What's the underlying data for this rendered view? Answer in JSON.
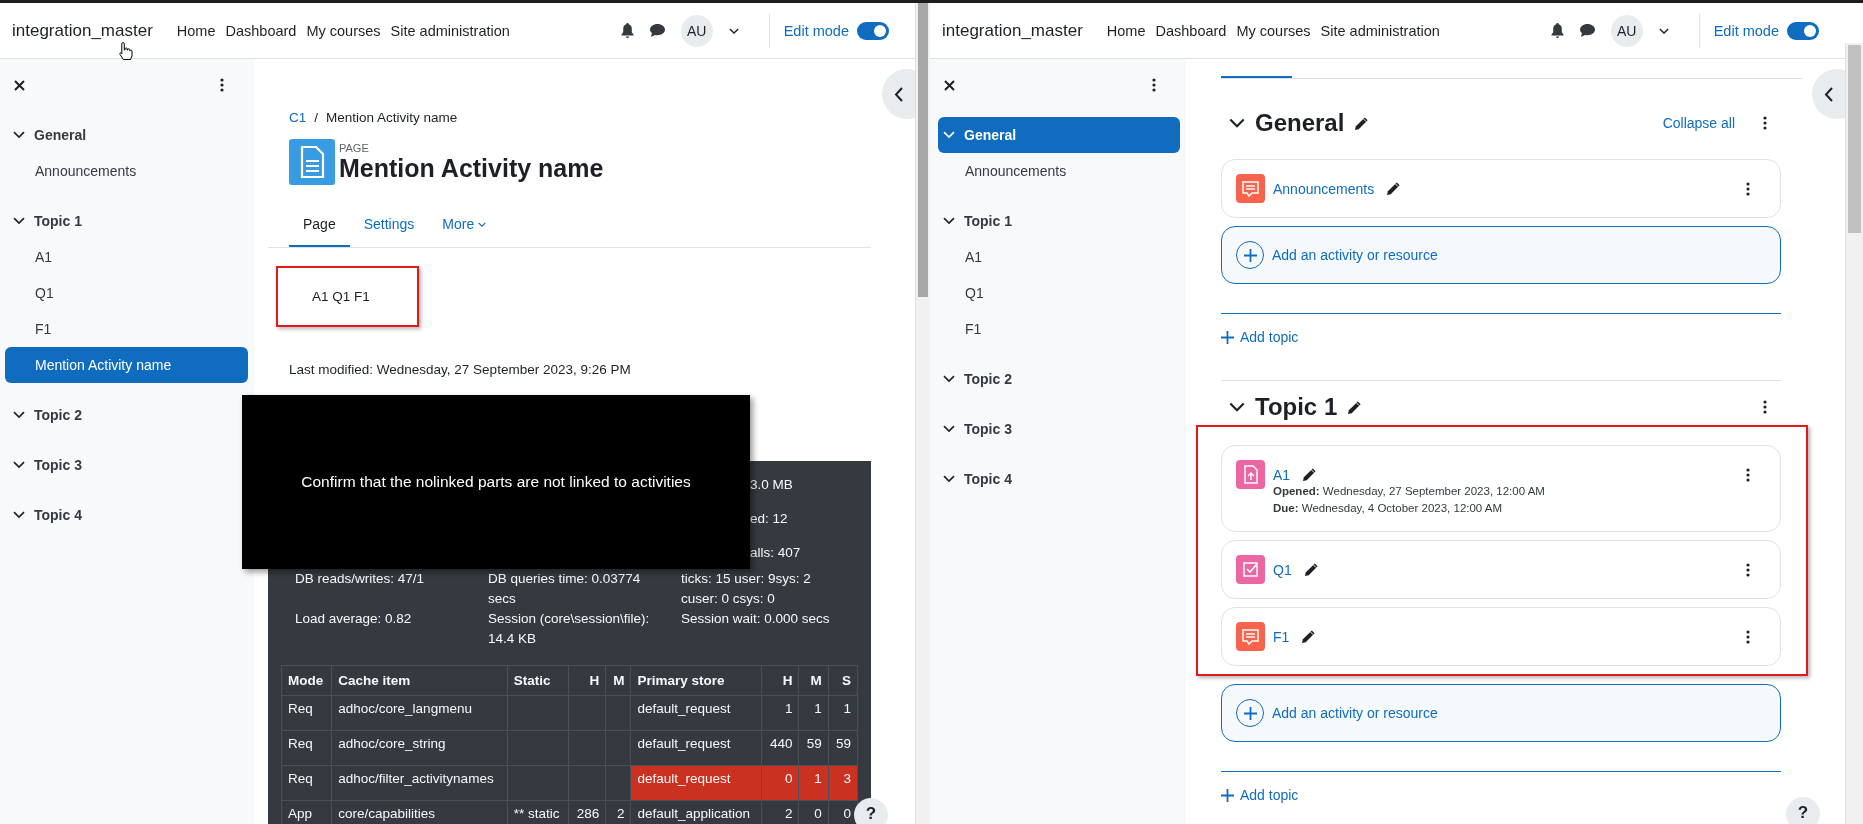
{
  "panes": [
    {
      "kind": "page",
      "navbar": {
        "brand": "integration_master",
        "links": [
          "Home",
          "Dashboard",
          "My courses",
          "Site administration"
        ],
        "avatar": "AU",
        "edit_mode": {
          "label": "Edit mode",
          "on": true
        },
        "cursor": true
      },
      "sidebar": {
        "sections": [
          {
            "label": "General",
            "expanded": true,
            "selected": false,
            "children": [
              {
                "label": "Announcements",
                "selected": false
              }
            ]
          },
          {
            "label": "Topic 1",
            "expanded": true,
            "selected": false,
            "children": [
              {
                "label": "A1",
                "selected": false
              },
              {
                "label": "Q1",
                "selected": false
              },
              {
                "label": "F1",
                "selected": false
              },
              {
                "label": "Mention Activity name",
                "selected": true
              }
            ]
          },
          {
            "label": "Topic 2",
            "expanded": true,
            "selected": false
          },
          {
            "label": "Topic 3",
            "expanded": true,
            "selected": false
          },
          {
            "label": "Topic 4",
            "expanded": true,
            "selected": false
          }
        ]
      },
      "main": {
        "breadcrumb": [
          "C1",
          "Mention Activity name"
        ],
        "breadcrumb_separator": "/",
        "type_label": "PAGE",
        "title": "Mention Activity name",
        "tabs": [
          {
            "label": "Page",
            "selected": true,
            "kind": "link"
          },
          {
            "label": "Settings",
            "selected": false,
            "kind": "link"
          },
          {
            "label": "More",
            "selected": false,
            "kind": "dropdown"
          }
        ],
        "content": {
          "text": "A1 Q1 F1",
          "highlighted": true
        },
        "last_modified": "Last modified: Wednesday, 27 September 2023, 9:26 PM",
        "caption": "Confirm that the nolinked parts are not linked to activities",
        "perf": {
          "fragments": [
            "3.0 MB",
            "ed: 12",
            "alls: 407"
          ],
          "stats": [
            [
              "DB reads/writes: 47/1",
              "DB queries time: 0.03774 secs",
              "ticks: 15 user: 9sys: 2 cuser: 0 csys: 0"
            ],
            [
              "Load average: 0.82",
              "Session (core\\session\\file): 14.4 KB",
              "Session wait: 0.000 secs"
            ]
          ],
          "table": {
            "columns": [
              "Mode",
              "Cache item",
              "Static",
              "H",
              "M",
              "Primary store",
              "H",
              "M",
              "S"
            ],
            "rows": [
              {
                "mode": "Req",
                "item": "adhoc/core_langmenu",
                "store": "default_request",
                "store_h": "1",
                "store_m": "1",
                "store_s": "1",
                "alert": false
              },
              {
                "mode": "Req",
                "item": "adhoc/core_string",
                "store": "default_request",
                "store_h": "440",
                "store_m": "59",
                "store_s": "59",
                "alert": false
              },
              {
                "mode": "Req",
                "item": "adhoc/filter_activitynames",
                "store": "default_request",
                "store_h": "0",
                "store_m": "1",
                "store_s": "3",
                "alert": true
              },
              {
                "mode": "App",
                "item": "core/capabilities",
                "static": "** static",
                "h": "286",
                "m": "2",
                "store": "default_application",
                "store_h": "2",
                "store_m": "0",
                "store_s": "0",
                "alert": false
              }
            ]
          }
        }
      },
      "help": "?"
    },
    {
      "kind": "course",
      "navbar": {
        "brand": "integration_master",
        "links": [
          "Home",
          "Dashboard",
          "My courses",
          "Site administration"
        ],
        "avatar": "AU",
        "edit_mode": {
          "label": "Edit mode",
          "on": true
        }
      },
      "sidebar": {
        "sections": [
          {
            "label": "General",
            "expanded": true,
            "selected": true,
            "children": [
              {
                "label": "Announcements",
                "selected": false
              }
            ]
          },
          {
            "label": "Topic 1",
            "expanded": true,
            "selected": false,
            "children": [
              {
                "label": "A1",
                "selected": false
              },
              {
                "label": "Q1",
                "selected": false
              },
              {
                "label": "F1",
                "selected": false
              }
            ]
          },
          {
            "label": "Topic 2",
            "expanded": true,
            "selected": false
          },
          {
            "label": "Topic 3",
            "expanded": true,
            "selected": false
          },
          {
            "label": "Topic 4",
            "expanded": true,
            "selected": false
          }
        ]
      },
      "main": {
        "sections": [
          {
            "title": "General",
            "collapse_all": "Collapse all",
            "highlighted": false,
            "activities": [
              {
                "kind": "forum",
                "name": "Announcements"
              }
            ],
            "add_activity": "Add an activity or resource",
            "add_topic": "Add topic"
          },
          {
            "title": "Topic 1",
            "highlighted": true,
            "activities": [
              {
                "kind": "assign",
                "name": "A1",
                "details": [
                  "**Opened:** Wednesday, 27 September 2023, 12:00 AM",
                  "**Due:** Wednesday, 4 October 2023, 12:00 AM"
                ]
              },
              {
                "kind": "quiz",
                "name": "Q1"
              },
              {
                "kind": "forum",
                "name": "F1"
              }
            ],
            "add_activity": "Add an activity or resource",
            "add_topic": "Add topic"
          }
        ]
      },
      "help": "?"
    }
  ]
}
